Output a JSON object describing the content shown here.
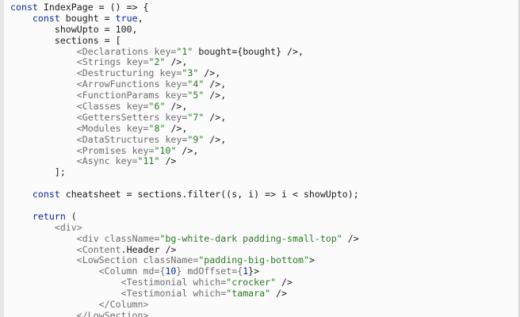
{
  "editor": {
    "lines": [
      {
        "tokens": [
          {
            "t": "const",
            "c": "kw"
          },
          {
            "t": " IndexPage = () => {",
            "c": ""
          }
        ]
      },
      {
        "tokens": [
          {
            "t": "    ",
            "c": ""
          },
          {
            "t": "const",
            "c": "kw"
          },
          {
            "t": " bought = ",
            "c": ""
          },
          {
            "t": "true",
            "c": "kw"
          },
          {
            "t": ",",
            "c": ""
          }
        ]
      },
      {
        "tokens": [
          {
            "t": "        showUpto = 100,",
            "c": ""
          }
        ]
      },
      {
        "tokens": [
          {
            "t": "        sections = [",
            "c": ""
          }
        ]
      },
      {
        "tokens": [
          {
            "t": "            <Declarations",
            "c": "tag"
          },
          {
            "t": " key=",
            "c": "tag"
          },
          {
            "t": "\"1\"",
            "c": "str"
          },
          {
            "t": " bought={bought} />,",
            "c": ""
          }
        ]
      },
      {
        "tokens": [
          {
            "t": "            <Strings",
            "c": "tag"
          },
          {
            "t": " key=",
            "c": "tag"
          },
          {
            "t": "\"2\"",
            "c": "str"
          },
          {
            "t": " />,",
            "c": ""
          }
        ]
      },
      {
        "tokens": [
          {
            "t": "            <Destructuring",
            "c": "tag"
          },
          {
            "t": " key=",
            "c": "tag"
          },
          {
            "t": "\"3\"",
            "c": "str"
          },
          {
            "t": " />,",
            "c": ""
          }
        ]
      },
      {
        "tokens": [
          {
            "t": "            <ArrowFunctions",
            "c": "tag"
          },
          {
            "t": " key=",
            "c": "tag"
          },
          {
            "t": "\"4\"",
            "c": "str"
          },
          {
            "t": " />,",
            "c": ""
          }
        ]
      },
      {
        "tokens": [
          {
            "t": "            <FunctionParams",
            "c": "tag"
          },
          {
            "t": " key=",
            "c": "tag"
          },
          {
            "t": "\"5\"",
            "c": "str"
          },
          {
            "t": " />,",
            "c": ""
          }
        ]
      },
      {
        "tokens": [
          {
            "t": "            <Classes",
            "c": "tag"
          },
          {
            "t": " key=",
            "c": "tag"
          },
          {
            "t": "\"6\"",
            "c": "str"
          },
          {
            "t": " />,",
            "c": ""
          }
        ]
      },
      {
        "tokens": [
          {
            "t": "            <GettersSetters",
            "c": "tag"
          },
          {
            "t": " key=",
            "c": "tag"
          },
          {
            "t": "\"7\"",
            "c": "str"
          },
          {
            "t": " />,",
            "c": ""
          }
        ]
      },
      {
        "tokens": [
          {
            "t": "            <Modules",
            "c": "tag"
          },
          {
            "t": " key=",
            "c": "tag"
          },
          {
            "t": "\"8\"",
            "c": "str"
          },
          {
            "t": " />,",
            "c": ""
          }
        ]
      },
      {
        "tokens": [
          {
            "t": "            <DataStructures",
            "c": "tag"
          },
          {
            "t": " key=",
            "c": "tag"
          },
          {
            "t": "\"9\"",
            "c": "str"
          },
          {
            "t": " />,",
            "c": ""
          }
        ]
      },
      {
        "tokens": [
          {
            "t": "            <Promises",
            "c": "tag"
          },
          {
            "t": " key=",
            "c": "tag"
          },
          {
            "t": "\"10\"",
            "c": "str"
          },
          {
            "t": " />,",
            "c": ""
          }
        ]
      },
      {
        "tokens": [
          {
            "t": "            <Async",
            "c": "tag"
          },
          {
            "t": " key=",
            "c": "tag"
          },
          {
            "t": "\"11\"",
            "c": "str"
          },
          {
            "t": " />",
            "c": ""
          }
        ]
      },
      {
        "tokens": [
          {
            "t": "        ];",
            "c": ""
          }
        ]
      },
      {
        "tokens": [
          {
            "t": "",
            "c": ""
          }
        ]
      },
      {
        "tokens": [
          {
            "t": "    ",
            "c": ""
          },
          {
            "t": "const",
            "c": "kw"
          },
          {
            "t": " cheatsheet = sections.filter((s, i) => i < showUpto);",
            "c": ""
          }
        ]
      },
      {
        "tokens": [
          {
            "t": "",
            "c": ""
          }
        ]
      },
      {
        "tokens": [
          {
            "t": "    ",
            "c": ""
          },
          {
            "t": "return",
            "c": "kw"
          },
          {
            "t": " (",
            "c": ""
          }
        ]
      },
      {
        "tokens": [
          {
            "t": "        <div>",
            "c": "tag"
          }
        ]
      },
      {
        "tokens": [
          {
            "t": "            <div",
            "c": "tag"
          },
          {
            "t": " className=",
            "c": "tag"
          },
          {
            "t": "\"bg-white-dark padding-small-top\"",
            "c": "str"
          },
          {
            "t": " />",
            "c": ""
          }
        ]
      },
      {
        "tokens": [
          {
            "t": "            <Content",
            "c": "tag"
          },
          {
            "t": ".Header />",
            "c": ""
          }
        ]
      },
      {
        "tokens": [
          {
            "t": "            <LowSection",
            "c": "tag"
          },
          {
            "t": " className=",
            "c": "tag"
          },
          {
            "t": "\"padding-big-bottom\"",
            "c": "str"
          },
          {
            "t": ">",
            "c": ""
          }
        ]
      },
      {
        "tokens": [
          {
            "t": "                <Column",
            "c": "tag"
          },
          {
            "t": " md={",
            "c": "tag"
          },
          {
            "t": "10",
            "c": "num"
          },
          {
            "t": "} mdOffset={",
            "c": "tag"
          },
          {
            "t": "1",
            "c": "num"
          },
          {
            "t": "}>",
            "c": ""
          }
        ]
      },
      {
        "tokens": [
          {
            "t": "                    <Testimonial",
            "c": "tag"
          },
          {
            "t": " which=",
            "c": "tag"
          },
          {
            "t": "\"crocker\"",
            "c": "str"
          },
          {
            "t": " />",
            "c": ""
          }
        ]
      },
      {
        "tokens": [
          {
            "t": "                    <Testimonial",
            "c": "tag"
          },
          {
            "t": " which=",
            "c": "tag"
          },
          {
            "t": "\"tamara\"",
            "c": "str"
          },
          {
            "t": " />",
            "c": ""
          }
        ]
      },
      {
        "tokens": [
          {
            "t": "                </Column>",
            "c": "tag"
          }
        ]
      },
      {
        "tokens": [
          {
            "t": "            </LowSection>",
            "c": "tag"
          }
        ]
      }
    ]
  }
}
